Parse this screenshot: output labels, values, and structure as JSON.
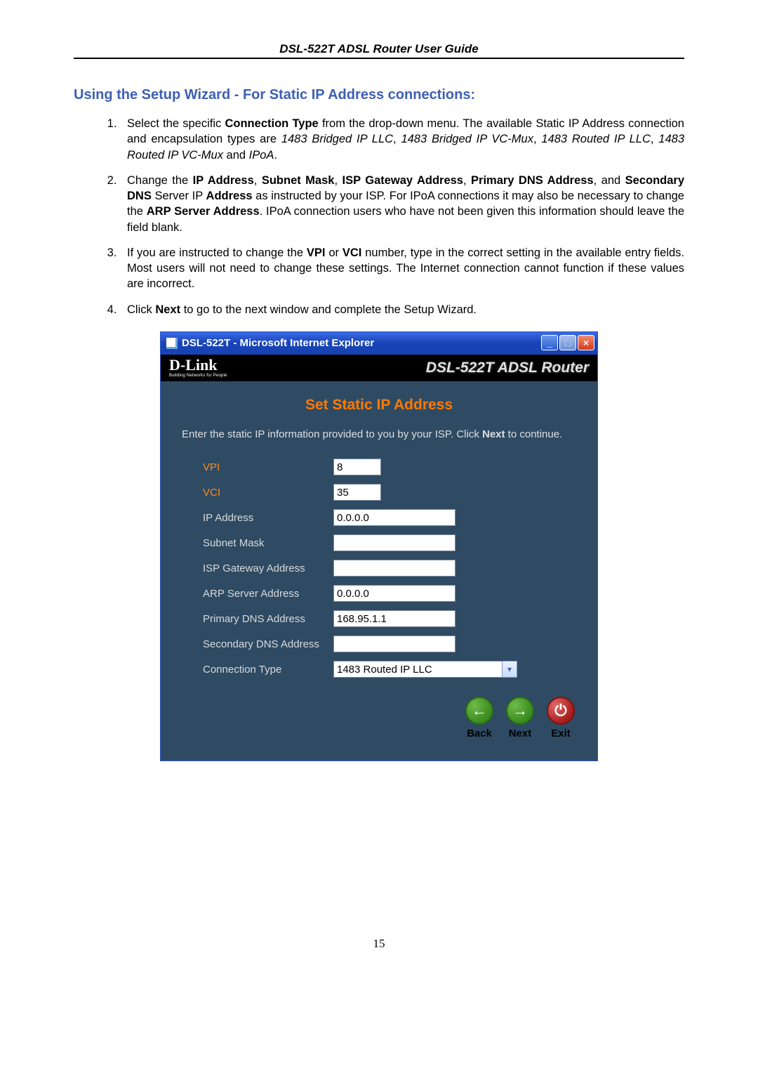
{
  "header": {
    "title": "DSL-522T ADSL Router User Guide"
  },
  "section_title": "Using the Setup Wizard - For Static IP Address connections:",
  "steps": [
    {
      "pre": "Select the specific ",
      "b1": "Connection Type",
      "mid1": " from the drop-down menu. The available Static IP Address connection and encapsulation types are ",
      "i1": "1483 Bridged IP LLC",
      "c1": ", ",
      "i2": "1483 Bridged IP VC-Mux",
      "c2": ", ",
      "i3": "1483 Routed IP LLC",
      "c3": ", ",
      "i4": "1483 Routed IP VC-Mux",
      "c4": " and ",
      "i5": "IPoA",
      "end": "."
    },
    {
      "pre": "Change the ",
      "b1": "IP Address",
      "c1": ", ",
      "b2": "Subnet Mask",
      "c2": ", ",
      "b3": "ISP Gateway Address",
      "c3": ", ",
      "b4": "Primary DNS Address",
      "c4": ", and ",
      "b5": "Secondary DNS",
      "mid1": " Server IP ",
      "b6": "Address",
      "mid2": " as instructed by your ISP. For IPoA connections it may also be necessary to change the ",
      "b7": "ARP Server Address",
      "end": ". IPoA connection users who have not been given this information should leave the field blank."
    },
    {
      "pre": "If you are instructed to change the ",
      "b1": "VPI",
      "c1": " or ",
      "b2": "VCI",
      "end": " number, type in the correct setting in the available entry fields. Most users will not need to change these settings. The Internet connection cannot function if these values are incorrect."
    },
    {
      "pre": "Click ",
      "b1": "Next",
      "end": " to go to the next window and complete the Setup Wizard."
    }
  ],
  "ie_window": {
    "title": "DSL-522T - Microsoft Internet Explorer",
    "banner_logo": "D-Link",
    "banner_sub": "Building Networks for People",
    "banner_product": "DSL-522T ADSL Router",
    "wizard_heading": "Set Static IP Address",
    "wizard_instr_pre": "Enter the static IP information provided to you by your ISP. Click ",
    "wizard_instr_bold": "Next",
    "wizard_instr_post": " to continue.",
    "fields": {
      "vpi": {
        "label": "VPI",
        "value": "8"
      },
      "vci": {
        "label": "VCI",
        "value": "35"
      },
      "ip": {
        "label": "IP Address",
        "value": "0.0.0.0"
      },
      "mask": {
        "label": "Subnet Mask",
        "value": ""
      },
      "gw": {
        "label": "ISP Gateway Address",
        "value": ""
      },
      "arp": {
        "label": "ARP Server Address",
        "value": "0.0.0.0"
      },
      "dns1": {
        "label": "Primary DNS Address",
        "value": "168.95.1.1"
      },
      "dns2": {
        "label": "Secondary DNS Address",
        "value": ""
      },
      "conn": {
        "label": "Connection Type",
        "value": "1483 Routed IP LLC"
      }
    },
    "nav": {
      "back": "Back",
      "next": "Next",
      "exit": "Exit"
    }
  },
  "page_number": "15"
}
